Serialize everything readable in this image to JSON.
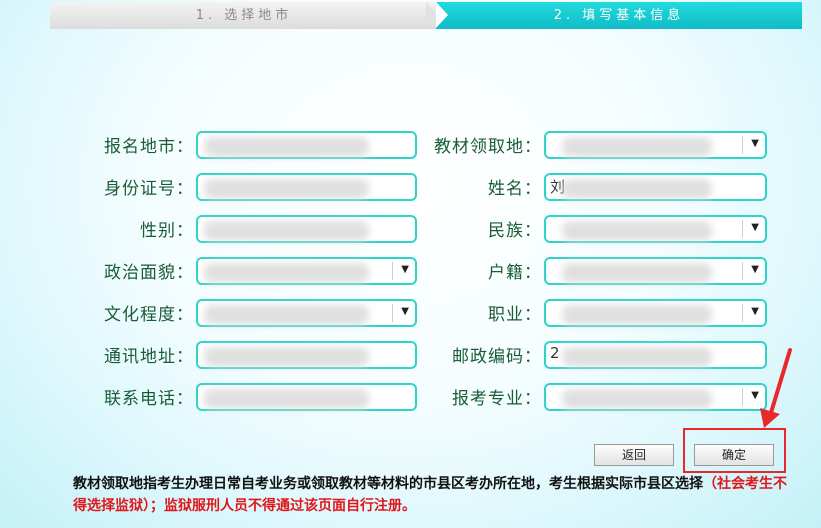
{
  "steps": [
    {
      "label": "1. 选择地市",
      "state": "done"
    },
    {
      "label": "2. 填写基本信息",
      "state": "active"
    }
  ],
  "form": {
    "left": [
      {
        "label": "报名地市：",
        "type": "text",
        "value_hint": "",
        "partial": ""
      },
      {
        "label": "身份证号：",
        "type": "text",
        "value_hint": "",
        "partial": ""
      },
      {
        "label": "性别：",
        "type": "text",
        "value_hint": "",
        "partial": ""
      },
      {
        "label": "政治面貌：",
        "type": "select",
        "value_hint": "",
        "partial": ""
      },
      {
        "label": "文化程度：",
        "type": "select",
        "value_hint": "",
        "partial": ""
      },
      {
        "label": "通讯地址：",
        "type": "text",
        "value_hint": "",
        "partial": ""
      },
      {
        "label": "联系电话：",
        "type": "text",
        "value_hint": "",
        "partial": ""
      }
    ],
    "right": [
      {
        "label": "教材领取地：",
        "type": "select",
        "partial": ""
      },
      {
        "label": "姓名：",
        "type": "text",
        "partial": "刘"
      },
      {
        "label": "民族：",
        "type": "select",
        "partial": ""
      },
      {
        "label": "户籍：",
        "type": "select",
        "partial": ""
      },
      {
        "label": "职业：",
        "type": "select",
        "partial": ""
      },
      {
        "label": "邮政编码：",
        "type": "text",
        "partial": "2"
      },
      {
        "label": "报考专业：",
        "type": "select",
        "partial": ""
      }
    ],
    "select_arrow": "▼"
  },
  "buttons": {
    "back": "返回",
    "confirm": "确定"
  },
  "annotation": {
    "color": "#e8282a",
    "target": "confirm-button"
  },
  "note": {
    "main": "教材领取地指考生办理日常自考业务或领取教材等材料的市县区考办所在地，考生根据实际市县区选择",
    "warning": "（社会考生不得选择监狱）；监狱服刑人员不得通过该页面自行注册。"
  },
  "colors": {
    "label": "#1a5c36",
    "field_border": "#2fd4c8",
    "step_active": "#10bcc6",
    "warning_text": "#e0161b"
  }
}
